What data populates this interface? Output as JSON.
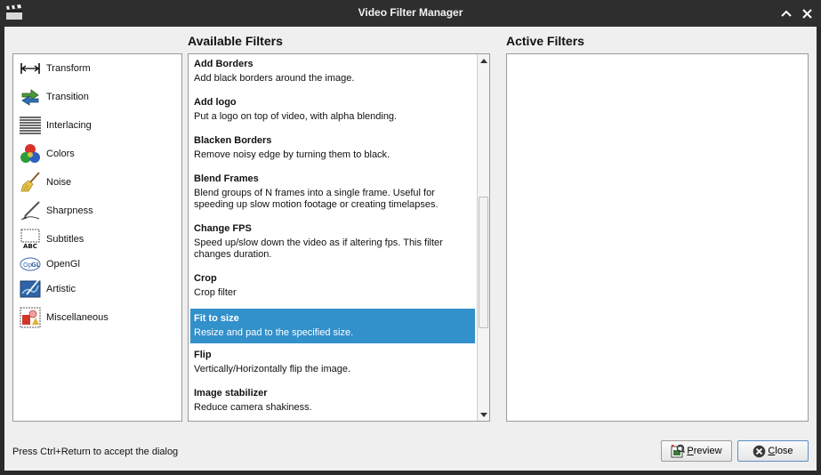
{
  "window": {
    "title": "Video Filter Manager"
  },
  "categories": [
    {
      "label": "Transform",
      "icon": "transform-icon"
    },
    {
      "label": "Transition",
      "icon": "transition-icon"
    },
    {
      "label": "Interlacing",
      "icon": "interlacing-icon"
    },
    {
      "label": "Colors",
      "icon": "colors-icon"
    },
    {
      "label": "Noise",
      "icon": "noise-icon"
    },
    {
      "label": "Sharpness",
      "icon": "sharpness-icon"
    },
    {
      "label": "Subtitles",
      "icon": "subtitles-icon"
    },
    {
      "label": "OpenGl",
      "icon": "opengl-icon"
    },
    {
      "label": "Artistic",
      "icon": "artistic-icon"
    },
    {
      "label": "Miscellaneous",
      "icon": "miscellaneous-icon"
    }
  ],
  "available": {
    "heading": "Available Filters",
    "filters": [
      {
        "name": "Add Borders",
        "desc": "Add black borders around the image."
      },
      {
        "name": "Add logo",
        "desc": "Put a logo on top of video, with alpha blending."
      },
      {
        "name": "Blacken Borders",
        "desc": "Remove noisy edge by turning them to black."
      },
      {
        "name": "Blend Frames",
        "desc": "Blend groups of N frames into a single frame.  Useful for speeding up slow motion footage or creating timelapses."
      },
      {
        "name": "Change FPS",
        "desc": "Speed up/slow down the video as if altering fps. This filter changes duration."
      },
      {
        "name": "Crop",
        "desc": "Crop filter"
      },
      {
        "name": "Fit to size",
        "desc": "Resize and pad to the specified size.",
        "selected": true
      },
      {
        "name": "Flip",
        "desc": "Vertically/Horizontally flip the image."
      },
      {
        "name": "Image stabilizer",
        "desc": "Reduce camera shakiness."
      }
    ],
    "scroll_position": 0.62
  },
  "active": {
    "heading": "Active Filters"
  },
  "footer": {
    "hint": "Press Ctrl+Return to accept the dialog",
    "preview_label": "Preview",
    "close_label": "Close"
  }
}
